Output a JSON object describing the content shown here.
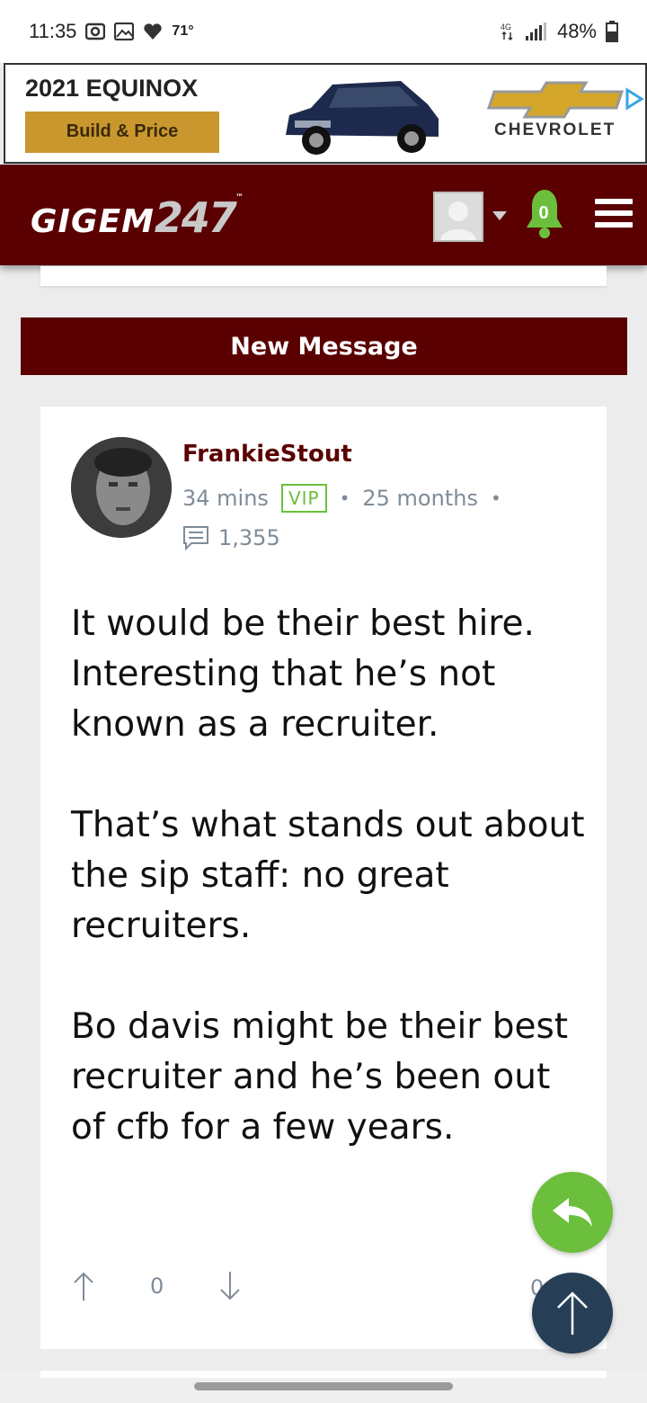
{
  "status_bar": {
    "time": "11:35",
    "temperature": "71°",
    "battery": "48%",
    "icons": [
      "screen-record-icon",
      "gallery-icon",
      "heart-icon",
      "data-4g-icon",
      "signal-icon",
      "battery-icon"
    ]
  },
  "ad": {
    "title": "2021 EQUINOX",
    "cta_label": "Build & Price",
    "brand": "CHEVROLET",
    "cta_color": "#c9972e"
  },
  "header": {
    "logo_text": "GIGEM",
    "logo_number": "247",
    "logo_tm": "™",
    "notification_count": "0",
    "brand_color": "#5a0000",
    "notification_color": "#6cbf3c"
  },
  "new_message_label": "New Message",
  "post": {
    "username": "FrankieStout",
    "time_ago": "34 mins",
    "badge": "VIP",
    "member_for": "25 months",
    "post_count": "1,355",
    "body": [
      "It would be their best hire. Interesting that he’s not known as a recruiter.",
      "That’s what stands out about the sip staff: no great recruiters.",
      "Bo davis might be their best recruiter and he’s been out of cfb for a few years."
    ],
    "vote_score": "0",
    "partial_count": "0"
  },
  "colors": {
    "reply_fab": "#6cbf3c",
    "top_fab": "#263f57",
    "meta_text": "#7f8c99"
  }
}
